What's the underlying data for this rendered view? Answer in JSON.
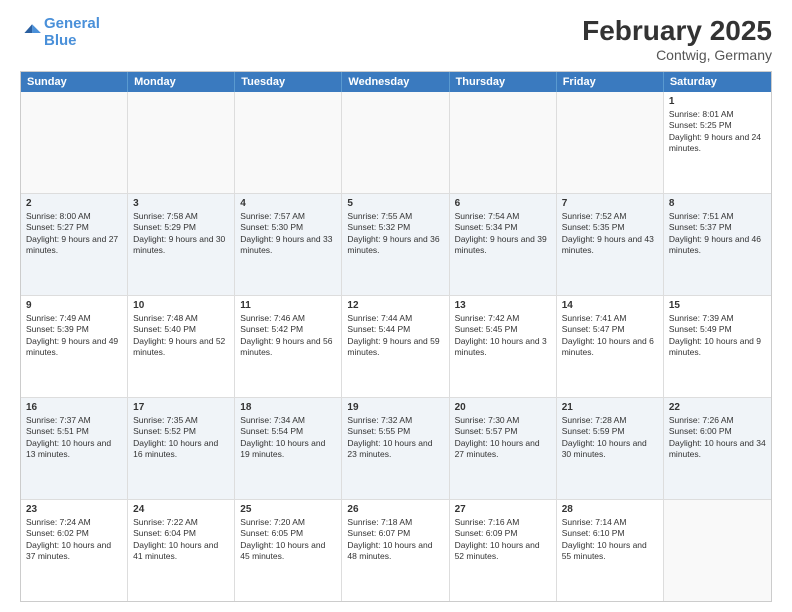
{
  "header": {
    "logo_line1": "General",
    "logo_line2": "Blue",
    "title": "February 2025",
    "subtitle": "Contwig, Germany"
  },
  "days": [
    "Sunday",
    "Monday",
    "Tuesday",
    "Wednesday",
    "Thursday",
    "Friday",
    "Saturday"
  ],
  "rows": [
    [
      {
        "day": "",
        "text": "",
        "empty": true
      },
      {
        "day": "",
        "text": "",
        "empty": true
      },
      {
        "day": "",
        "text": "",
        "empty": true
      },
      {
        "day": "",
        "text": "",
        "empty": true
      },
      {
        "day": "",
        "text": "",
        "empty": true
      },
      {
        "day": "",
        "text": "",
        "empty": true
      },
      {
        "day": "1",
        "text": "Sunrise: 8:01 AM\nSunset: 5:25 PM\nDaylight: 9 hours and 24 minutes."
      }
    ],
    [
      {
        "day": "2",
        "text": "Sunrise: 8:00 AM\nSunset: 5:27 PM\nDaylight: 9 hours and 27 minutes."
      },
      {
        "day": "3",
        "text": "Sunrise: 7:58 AM\nSunset: 5:29 PM\nDaylight: 9 hours and 30 minutes."
      },
      {
        "day": "4",
        "text": "Sunrise: 7:57 AM\nSunset: 5:30 PM\nDaylight: 9 hours and 33 minutes."
      },
      {
        "day": "5",
        "text": "Sunrise: 7:55 AM\nSunset: 5:32 PM\nDaylight: 9 hours and 36 minutes."
      },
      {
        "day": "6",
        "text": "Sunrise: 7:54 AM\nSunset: 5:34 PM\nDaylight: 9 hours and 39 minutes."
      },
      {
        "day": "7",
        "text": "Sunrise: 7:52 AM\nSunset: 5:35 PM\nDaylight: 9 hours and 43 minutes."
      },
      {
        "day": "8",
        "text": "Sunrise: 7:51 AM\nSunset: 5:37 PM\nDaylight: 9 hours and 46 minutes."
      }
    ],
    [
      {
        "day": "9",
        "text": "Sunrise: 7:49 AM\nSunset: 5:39 PM\nDaylight: 9 hours and 49 minutes."
      },
      {
        "day": "10",
        "text": "Sunrise: 7:48 AM\nSunset: 5:40 PM\nDaylight: 9 hours and 52 minutes."
      },
      {
        "day": "11",
        "text": "Sunrise: 7:46 AM\nSunset: 5:42 PM\nDaylight: 9 hours and 56 minutes."
      },
      {
        "day": "12",
        "text": "Sunrise: 7:44 AM\nSunset: 5:44 PM\nDaylight: 9 hours and 59 minutes."
      },
      {
        "day": "13",
        "text": "Sunrise: 7:42 AM\nSunset: 5:45 PM\nDaylight: 10 hours and 3 minutes."
      },
      {
        "day": "14",
        "text": "Sunrise: 7:41 AM\nSunset: 5:47 PM\nDaylight: 10 hours and 6 minutes."
      },
      {
        "day": "15",
        "text": "Sunrise: 7:39 AM\nSunset: 5:49 PM\nDaylight: 10 hours and 9 minutes."
      }
    ],
    [
      {
        "day": "16",
        "text": "Sunrise: 7:37 AM\nSunset: 5:51 PM\nDaylight: 10 hours and 13 minutes."
      },
      {
        "day": "17",
        "text": "Sunrise: 7:35 AM\nSunset: 5:52 PM\nDaylight: 10 hours and 16 minutes."
      },
      {
        "day": "18",
        "text": "Sunrise: 7:34 AM\nSunset: 5:54 PM\nDaylight: 10 hours and 19 minutes."
      },
      {
        "day": "19",
        "text": "Sunrise: 7:32 AM\nSunset: 5:55 PM\nDaylight: 10 hours and 23 minutes."
      },
      {
        "day": "20",
        "text": "Sunrise: 7:30 AM\nSunset: 5:57 PM\nDaylight: 10 hours and 27 minutes."
      },
      {
        "day": "21",
        "text": "Sunrise: 7:28 AM\nSunset: 5:59 PM\nDaylight: 10 hours and 30 minutes."
      },
      {
        "day": "22",
        "text": "Sunrise: 7:26 AM\nSunset: 6:00 PM\nDaylight: 10 hours and 34 minutes."
      }
    ],
    [
      {
        "day": "23",
        "text": "Sunrise: 7:24 AM\nSunset: 6:02 PM\nDaylight: 10 hours and 37 minutes."
      },
      {
        "day": "24",
        "text": "Sunrise: 7:22 AM\nSunset: 6:04 PM\nDaylight: 10 hours and 41 minutes."
      },
      {
        "day": "25",
        "text": "Sunrise: 7:20 AM\nSunset: 6:05 PM\nDaylight: 10 hours and 45 minutes."
      },
      {
        "day": "26",
        "text": "Sunrise: 7:18 AM\nSunset: 6:07 PM\nDaylight: 10 hours and 48 minutes."
      },
      {
        "day": "27",
        "text": "Sunrise: 7:16 AM\nSunset: 6:09 PM\nDaylight: 10 hours and 52 minutes."
      },
      {
        "day": "28",
        "text": "Sunrise: 7:14 AM\nSunset: 6:10 PM\nDaylight: 10 hours and 55 minutes."
      },
      {
        "day": "",
        "text": "",
        "empty": true
      }
    ]
  ]
}
